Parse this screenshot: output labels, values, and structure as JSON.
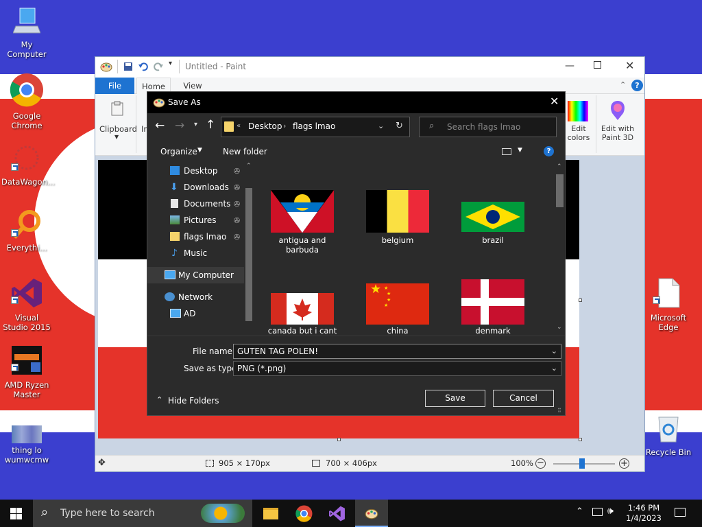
{
  "desktop": {
    "icons": [
      {
        "name": "my-computer",
        "label": "My Computer"
      },
      {
        "name": "google-chrome",
        "label": "Google Chrome"
      },
      {
        "name": "datawagon",
        "label": "DataWagon..."
      },
      {
        "name": "everything",
        "label": "Everythi..."
      },
      {
        "name": "visual-studio",
        "label": "Visual Studio 2015"
      },
      {
        "name": "amd-ryzen-master",
        "label": "AMD Ryzen Master"
      },
      {
        "name": "thing-lo",
        "label": "thing lo wumwcmw"
      },
      {
        "name": "microsoft-edge",
        "label": "Microsoft Edge"
      },
      {
        "name": "recycle-bin",
        "label": "Recycle Bin"
      }
    ],
    "colors": {
      "blue": "#3b3fcf",
      "red": "#e5332a",
      "white": "#ffffff"
    }
  },
  "paint": {
    "title": "Untitled - Paint",
    "tabs": [
      "File",
      "Home",
      "View"
    ],
    "ribbon": {
      "clipboard": "Clipboard",
      "image_partial": "Im",
      "edit_colors": "Edit colors",
      "edit_with_paint3d": "Edit with Paint 3D"
    },
    "status": {
      "selection": "905 × 170px",
      "canvas_size": "700 × 406px",
      "zoom": "100%"
    }
  },
  "save_dialog": {
    "title": "Save As",
    "breadcrumb": [
      "Desktop",
      "flags lmao"
    ],
    "search_placeholder": "Search flags lmao",
    "toolbar": {
      "organize": "Organize",
      "new_folder": "New folder"
    },
    "nav": [
      {
        "label": "Desktop",
        "pinned": true
      },
      {
        "label": "Downloads",
        "pinned": true
      },
      {
        "label": "Documents",
        "pinned": true
      },
      {
        "label": "Pictures",
        "pinned": true
      },
      {
        "label": "flags lmao",
        "pinned": true
      },
      {
        "label": "Music",
        "pinned": false
      },
      {
        "label": "My Computer",
        "pinned": false
      },
      {
        "label": "Network",
        "pinned": false
      },
      {
        "label": "AD",
        "pinned": false
      }
    ],
    "files": [
      {
        "label": "antigua and barbuda"
      },
      {
        "label": "belgium"
      },
      {
        "label": "brazil"
      },
      {
        "label": "canada but i cant"
      },
      {
        "label": "china"
      },
      {
        "label": "denmark"
      }
    ],
    "file_name_label": "File name:",
    "file_name_value": "GUTEN TAG POLEN!",
    "save_type_label": "Save as type:",
    "save_type_value": "PNG (*.png)",
    "hide_folders": "Hide Folders",
    "save_button": "Save",
    "cancel_button": "Cancel"
  },
  "taskbar": {
    "search_placeholder": "Type here to search",
    "time": "1:46 PM",
    "date": "1/4/2023"
  }
}
